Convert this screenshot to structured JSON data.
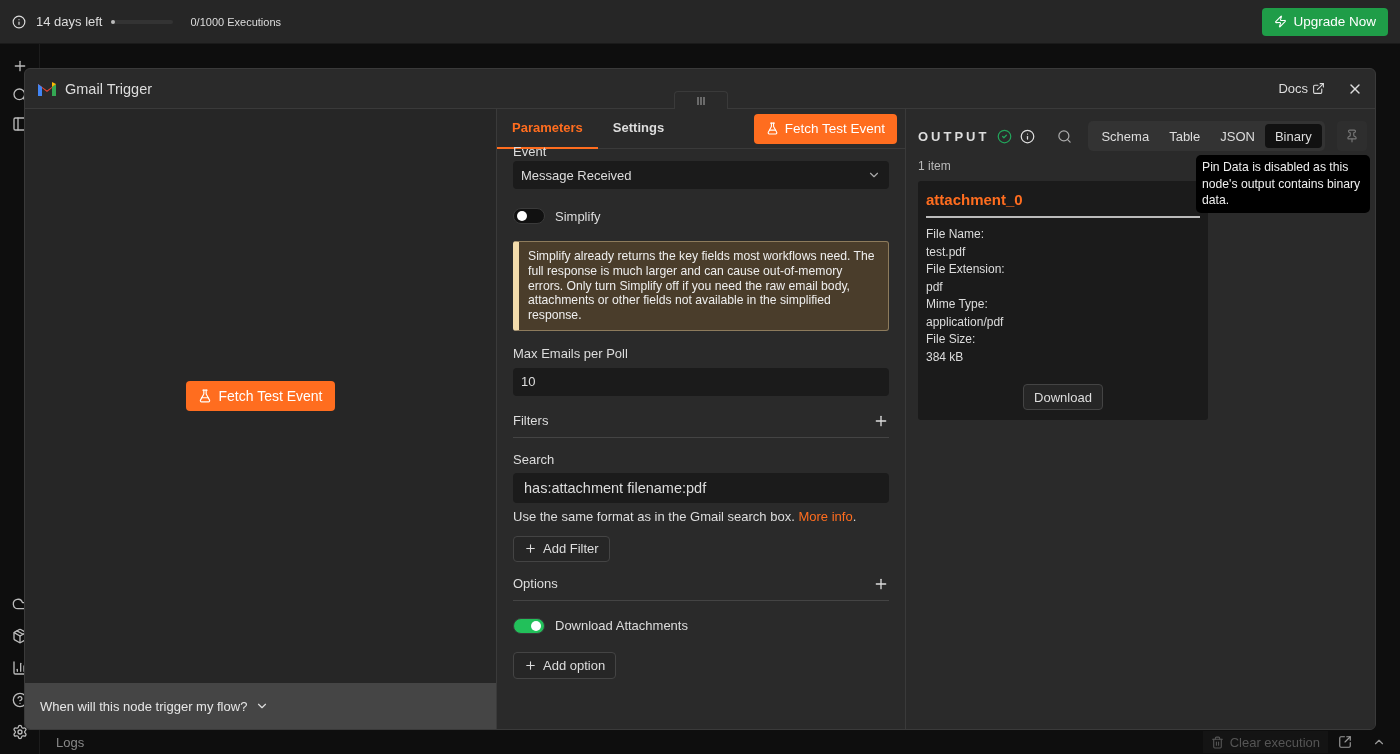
{
  "top_bar": {
    "trial_text": "14 days left",
    "trial_progress": {
      "level": 0.02
    },
    "executions": "0/1000 Executions",
    "upgrade_button": "Upgrade Now"
  },
  "modal": {
    "title": "Gmail Trigger",
    "docs_link": "Docs"
  },
  "input_panel": {
    "fetch_button": "Fetch Test Event",
    "trigger_question": "When will this node trigger my flow?"
  },
  "parameters": {
    "tabs": [
      {
        "label": "Parameters",
        "selected": true
      },
      {
        "label": "Settings",
        "selected": false
      }
    ],
    "fetch_button": "Fetch Test Event",
    "event_label": "Event",
    "event_value": "Message Received",
    "simplify": {
      "label": "Simplify",
      "on": false
    },
    "notice": "Simplify already returns the key fields most workflows need. The full response is much larger and can cause out-of-memory errors. Only turn Simplify off if you need the raw email body, attachments or other fields not available in the simplified response.",
    "max_emails": {
      "label": "Max Emails per Poll",
      "value": "10"
    },
    "filters": {
      "label": "Filters",
      "search_label": "Search",
      "search_value": "has:attachment filename:pdf",
      "hint": "Use the same format as in the Gmail search box.",
      "hint_link": "More info",
      "hint_end": ".",
      "add_button": "Add Filter"
    },
    "options": {
      "label": "Options",
      "download_attachments": {
        "label": "Download Attachments",
        "on": true
      },
      "add_button": "Add option"
    }
  },
  "output": {
    "title": "OUTPUT",
    "views": [
      {
        "label": "Schema",
        "selected": false
      },
      {
        "label": "Table",
        "selected": false
      },
      {
        "label": "JSON",
        "selected": false
      },
      {
        "label": "Binary",
        "selected": true
      }
    ],
    "item_count": "1 item",
    "attachment": {
      "name": "attachment_0",
      "fields": [
        {
          "label": "File Name:",
          "value": "test.pdf"
        },
        {
          "label": "File Extension:",
          "value": "pdf"
        },
        {
          "label": "Mime Type:",
          "value": "application/pdf"
        },
        {
          "label": "File Size:",
          "value": "384 kB"
        }
      ],
      "download_button": "Download"
    },
    "tooltip": "Pin Data is disabled as this node's output contains binary data."
  },
  "logs_bar": {
    "label": "Logs",
    "clear_button": "Clear execution"
  }
}
